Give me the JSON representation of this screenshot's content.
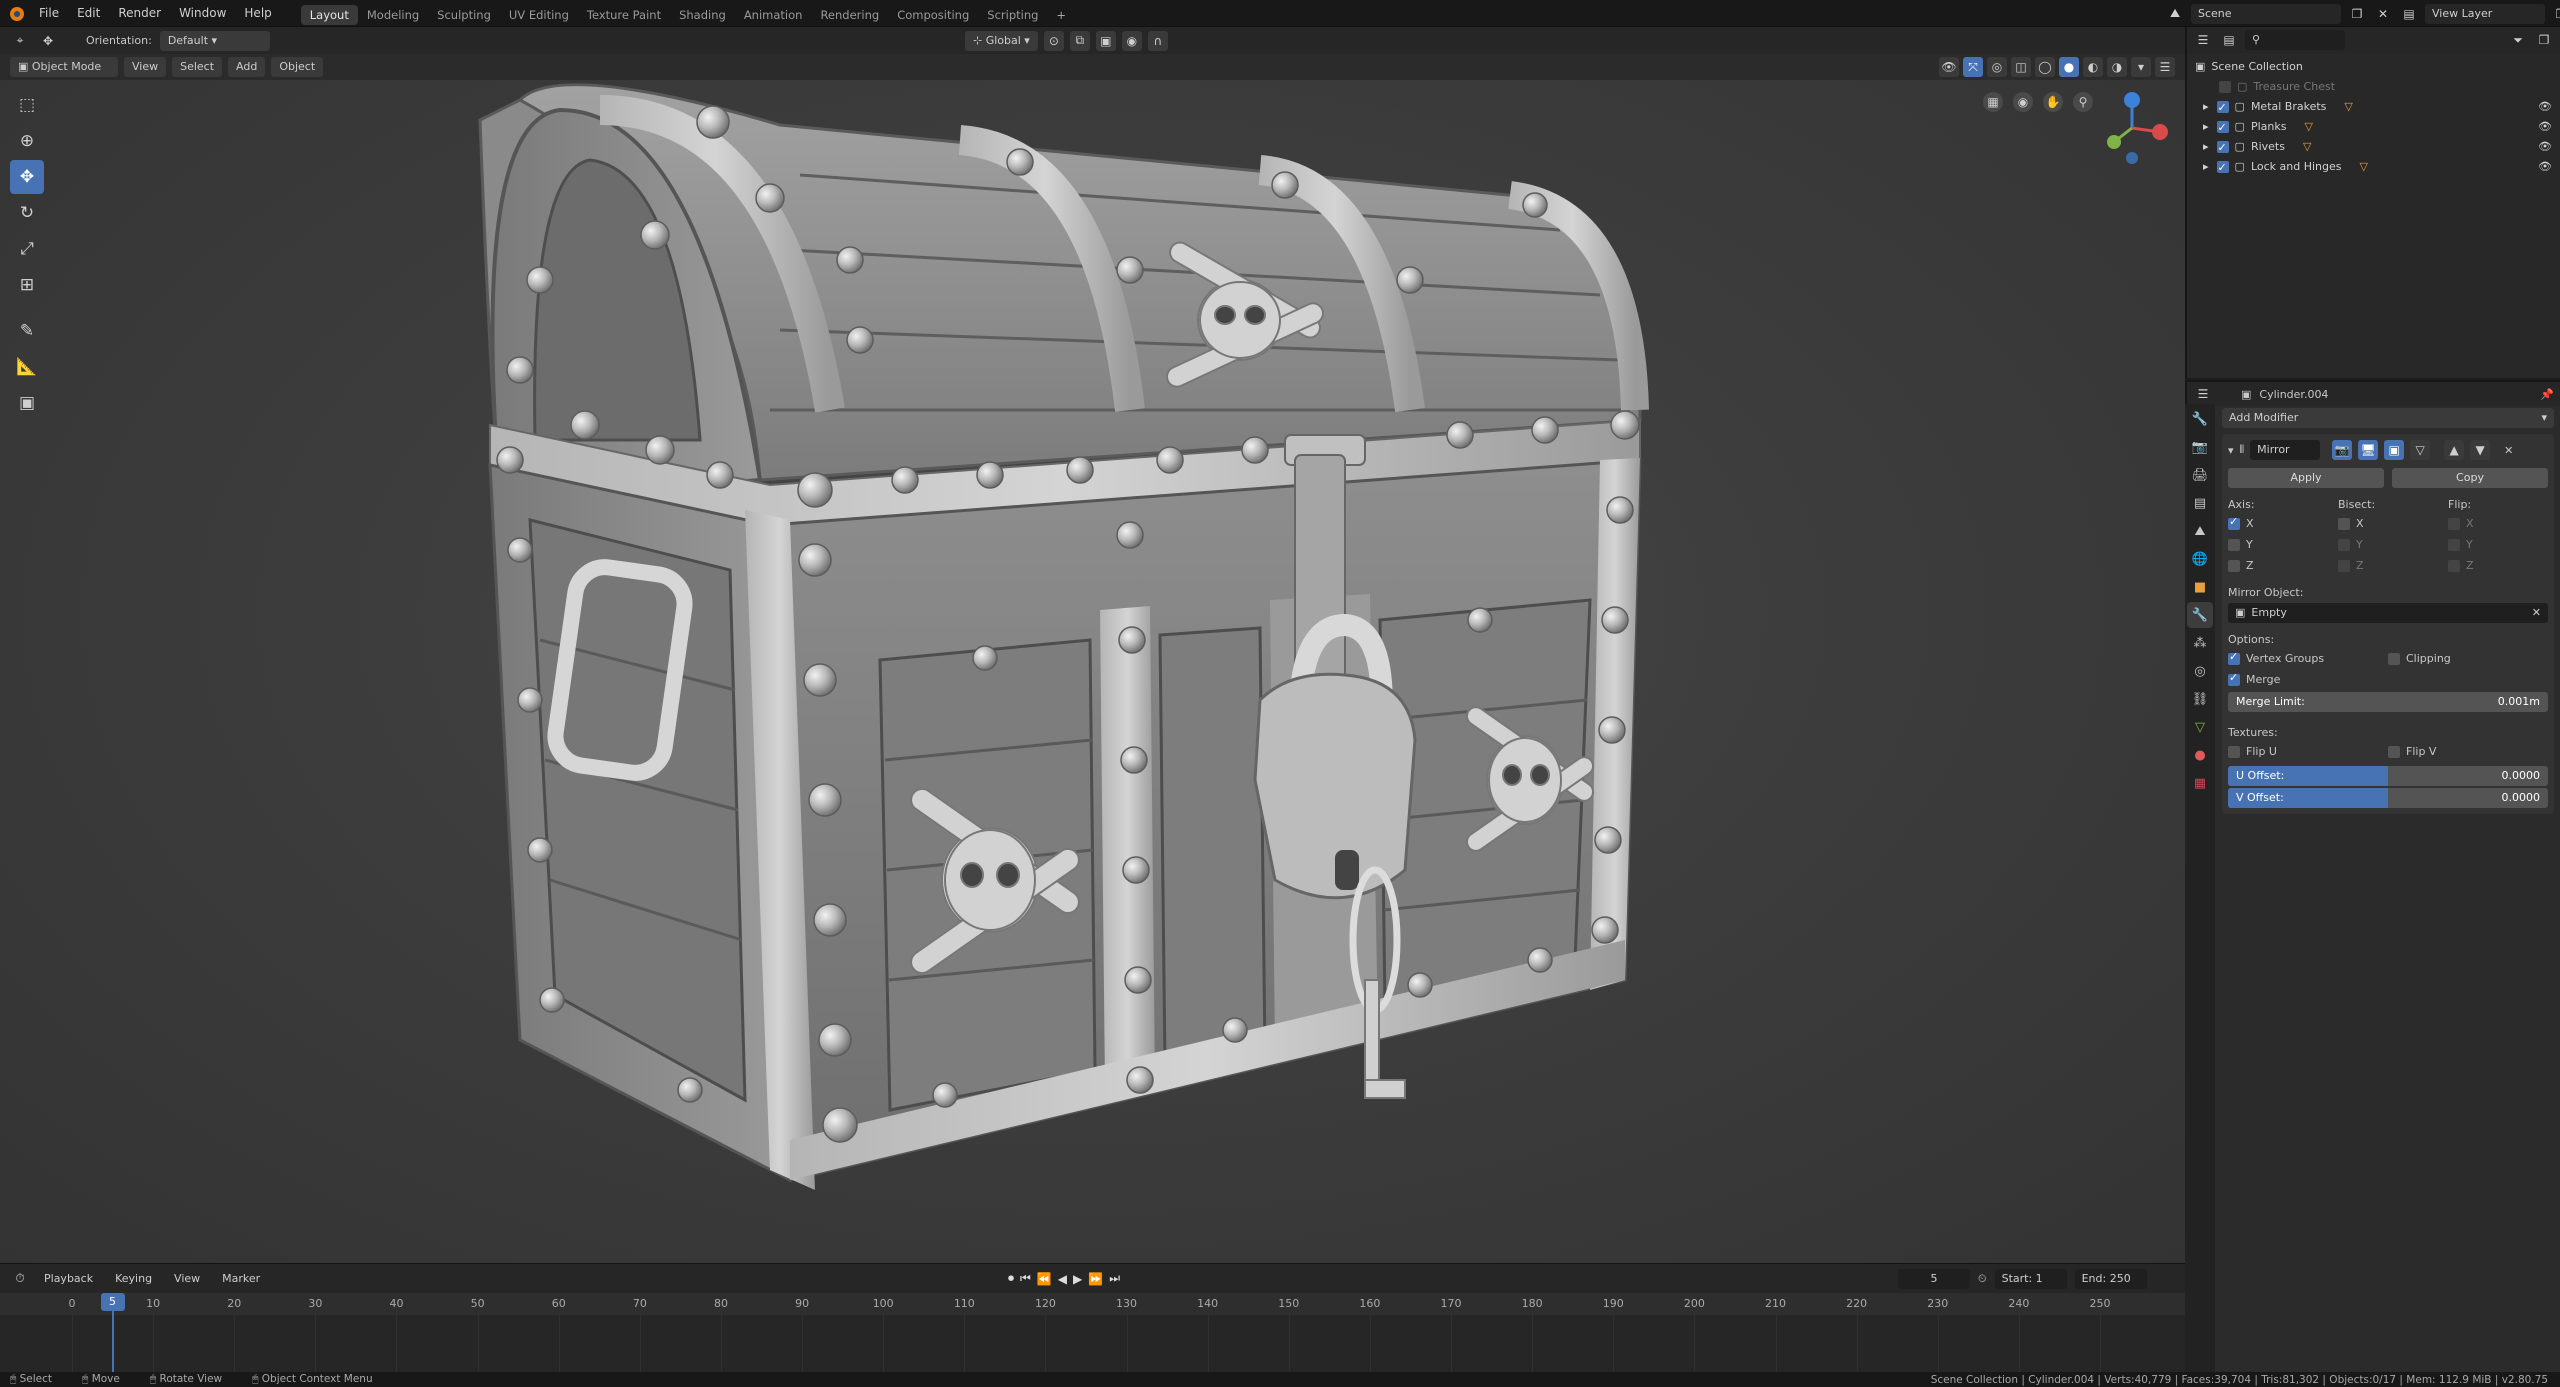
{
  "menu": {
    "items": [
      "File",
      "Edit",
      "Render",
      "Window",
      "Help"
    ],
    "workspaces": [
      "Layout",
      "Modeling",
      "Sculpting",
      "UV Editing",
      "Texture Paint",
      "Shading",
      "Animation",
      "Rendering",
      "Compositing",
      "Scripting"
    ],
    "active_workspace": "Layout",
    "scene": "Scene",
    "view_layer": "View Layer"
  },
  "viewport_header": {
    "orientation_label": "Orientation:",
    "orientation_value": "Default",
    "transform_space": "Global",
    "mode": "Object Mode",
    "menus": [
      "View",
      "Select",
      "Add",
      "Object"
    ]
  },
  "outliner": {
    "root": "Scene Collection",
    "items": [
      {
        "label": "Treasure Chest",
        "disabled": true
      },
      {
        "label": "Metal Brakets",
        "disabled": false
      },
      {
        "label": "Planks",
        "disabled": false
      },
      {
        "label": "Rivets",
        "disabled": false
      },
      {
        "label": "Lock and Hinges",
        "disabled": false
      }
    ]
  },
  "properties": {
    "object_name": "Cylinder.004",
    "add_modifier": "Add Modifier",
    "modifier_name": "Mirror",
    "apply": "Apply",
    "copy": "Copy",
    "axis_label": "Axis:",
    "bisect_label": "Bisect:",
    "flip_label": "Flip:",
    "axes": [
      "X",
      "Y",
      "Z"
    ],
    "mirror_object_label": "Mirror Object:",
    "mirror_object_value": "Empty",
    "options_label": "Options:",
    "vertex_groups": "Vertex Groups",
    "clipping": "Clipping",
    "merge": "Merge",
    "merge_limit_label": "Merge Limit:",
    "merge_limit_value": "0.001m",
    "textures_label": "Textures:",
    "flip_u": "Flip U",
    "flip_v": "Flip V",
    "u_offset_label": "U Offset:",
    "u_offset_value": "0.0000",
    "v_offset_label": "V Offset:",
    "v_offset_value": "0.0000"
  },
  "timeline": {
    "menus": [
      "Playback",
      "Keying",
      "View",
      "Marker"
    ],
    "current_frame": "5",
    "start_label": "Start:",
    "start_value": "1",
    "end_label": "End:",
    "end_value": "250",
    "ticks": [
      "0",
      "10",
      "20",
      "30",
      "40",
      "50",
      "60",
      "70",
      "80",
      "90",
      "100",
      "110",
      "120",
      "130",
      "140",
      "150",
      "160",
      "170",
      "180",
      "190",
      "200",
      "210",
      "220",
      "230",
      "240",
      "250"
    ]
  },
  "statusbar": {
    "select": "Select",
    "move": "Move",
    "rotate": "Rotate View",
    "context": "Object Context Menu",
    "stats": "Scene Collection | Cylinder.004 | Verts:40,779 | Faces:39,704 | Tris:81,302 | Objects:0/17 | Mem: 112.9 MiB | v2.80.75"
  },
  "colors": {
    "accent": "#4772b3",
    "panel": "#2b2b2b",
    "header": "#262626",
    "viewport": "#3d3d3d",
    "metal": "#9a9a9a"
  }
}
